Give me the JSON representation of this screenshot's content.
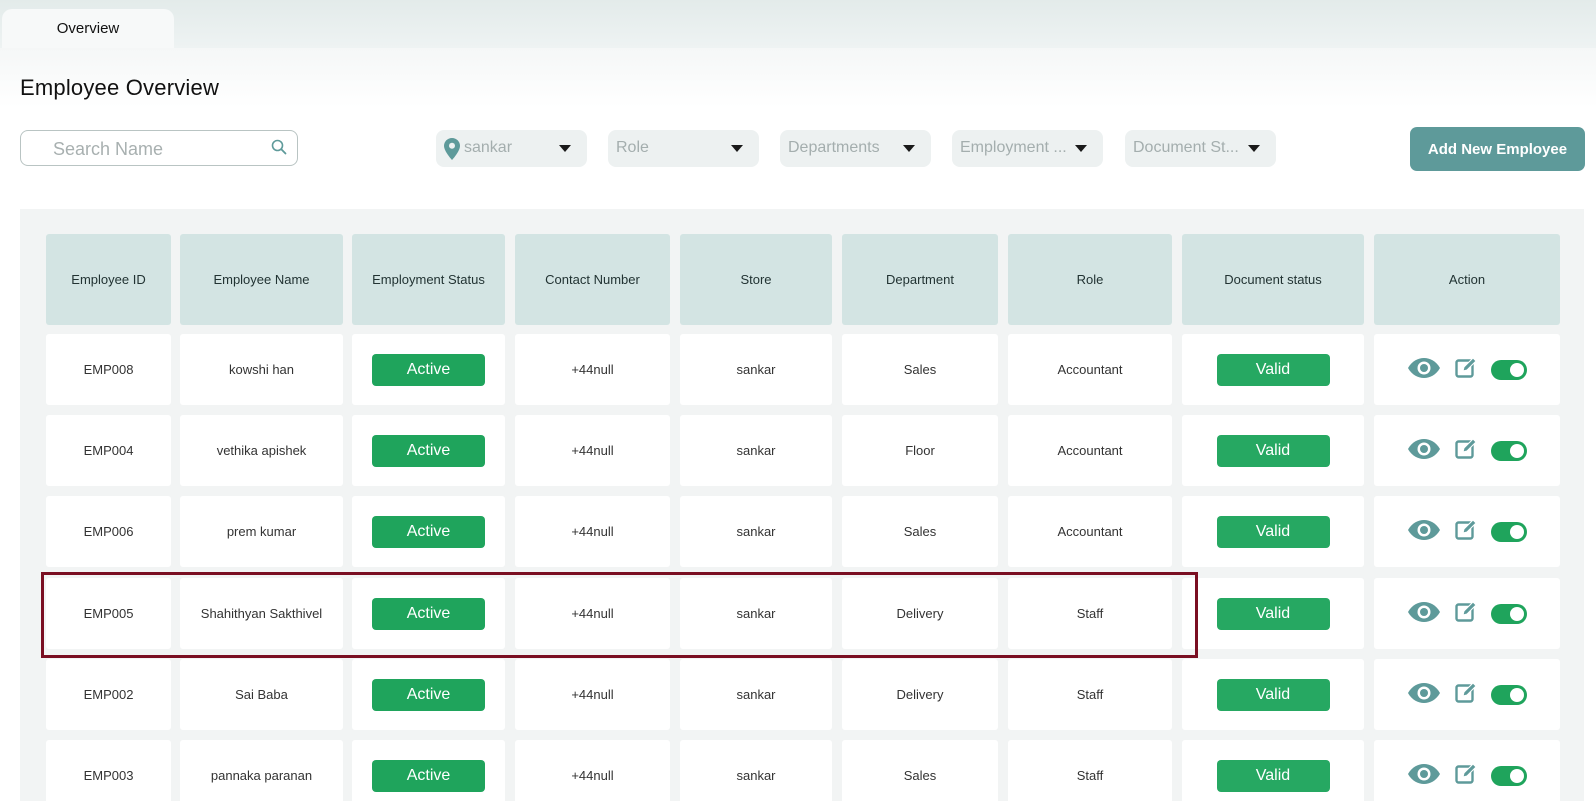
{
  "tabs": [
    {
      "label": "Overview"
    }
  ],
  "page_title": "Employee Overview",
  "search": {
    "placeholder": "Search Name"
  },
  "filters": [
    {
      "label": "sankar",
      "icon": "location-pin-icon"
    },
    {
      "label": "Role"
    },
    {
      "label": "Departments"
    },
    {
      "label": "Employment ..."
    },
    {
      "label": "Document St..."
    }
  ],
  "add_button_label": "Add New Employee",
  "table": {
    "columns": [
      "Employee ID",
      "Employee Name",
      "Employment Status",
      "Contact Number",
      "Store",
      "Department",
      "Role",
      "Document status",
      "Action"
    ],
    "rows": [
      {
        "id": "EMP008",
        "name": "kowshi han",
        "status": "Active",
        "contact": "+44null",
        "store": "sankar",
        "department": "Sales",
        "role": "Accountant",
        "doc_status": "Valid"
      },
      {
        "id": "EMP004",
        "name": "vethika apishek",
        "status": "Active",
        "contact": "+44null",
        "store": "sankar",
        "department": "Floor",
        "role": "Accountant",
        "doc_status": "Valid"
      },
      {
        "id": "EMP006",
        "name": "prem kumar",
        "status": "Active",
        "contact": "+44null",
        "store": "sankar",
        "department": "Sales",
        "role": "Accountant",
        "doc_status": "Valid"
      },
      {
        "id": "EMP005",
        "name": "Shahithyan Sakthivel",
        "status": "Active",
        "contact": "+44null",
        "store": "sankar",
        "department": "Delivery",
        "role": "Staff",
        "doc_status": "Valid"
      },
      {
        "id": "EMP002",
        "name": "Sai Baba",
        "status": "Active",
        "contact": "+44null",
        "store": "sankar",
        "department": "Delivery",
        "role": "Staff",
        "doc_status": "Valid"
      },
      {
        "id": "EMP003",
        "name": "pannaka paranan",
        "status": "Active",
        "contact": "+44null",
        "store": "sankar",
        "department": "Sales",
        "role": "Staff",
        "doc_status": "Valid"
      }
    ],
    "action_icons": [
      "eye-icon",
      "edit-icon",
      "toggle-switch"
    ]
  },
  "colors": {
    "accent": "#5e9a9a",
    "active_badge": "#1fa45c",
    "header_cell": "#d3e4e3",
    "highlight_border": "#7a0f22"
  }
}
